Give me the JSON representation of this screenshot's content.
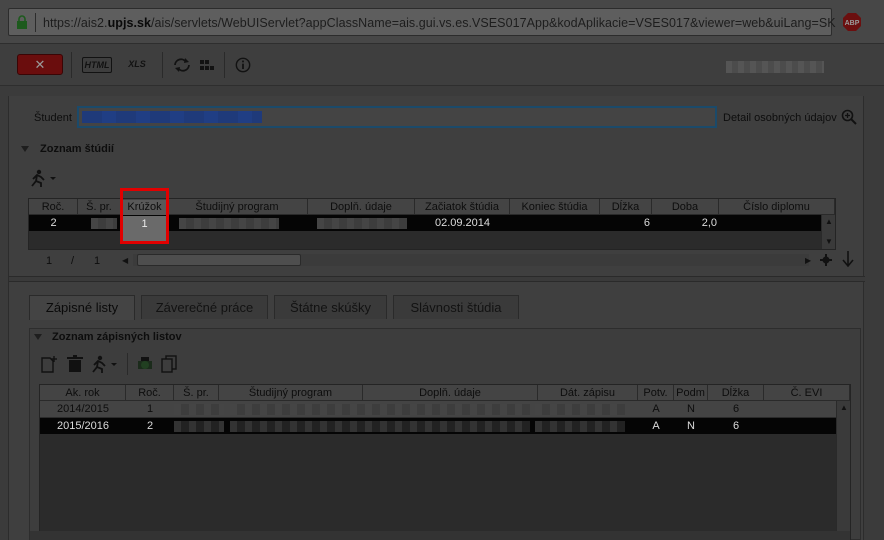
{
  "browser": {
    "url_prefix": "https://ais2.",
    "url_domain": "upjs.sk",
    "url_rest": "/ais/servlets/WebUIServlet?appClassName=ais.gui.vs.es.VSES017App&kodAplikacie=VSES017&viewer=web&uiLang=SK",
    "abp_label": "ABP"
  },
  "toolbar": {
    "close_label": "✕",
    "html_label": "HTML",
    "xls_label": "XLS"
  },
  "student": {
    "label": "Študent",
    "detail_label": "Detail osobných údajov"
  },
  "studies": {
    "title": "Zoznam štúdií",
    "columns": [
      "Roč.",
      "Š. pr.",
      "Krúžok",
      "Študijný program",
      "Doplň. údaje",
      "Začiatok štúdia",
      "Koniec štúdia",
      "Dĺžka",
      "Doba",
      "Číslo diplomu"
    ],
    "row": {
      "roc": "2",
      "kruzok": "1",
      "zaciatok": "02.09.2014",
      "dlzka": "6",
      "doba": "2,0"
    },
    "pager_current": "1",
    "pager_sep": "/",
    "pager_total": "1"
  },
  "tabs": [
    "Zápisné listy",
    "Záverečné práce",
    "Štátne skúšky",
    "Slávnosti štúdia"
  ],
  "enrollment": {
    "title": "Zoznam zápisných listov",
    "columns": [
      "Ak. rok",
      "Roč.",
      "Š. pr.",
      "Študijný program",
      "Doplň. údaje",
      "Dát. zápisu",
      "Potv.",
      "Podm",
      "Dĺžka",
      "Č. EVI"
    ],
    "rows": [
      {
        "ak_rok": "2014/2015",
        "roc": "1",
        "potv": "A",
        "podm": "N",
        "dlzka": "6"
      },
      {
        "ak_rok": "2015/2016",
        "roc": "2",
        "potv": "A",
        "podm": "N",
        "dlzka": "6"
      }
    ]
  },
  "colors": {
    "highlight": "#e10000",
    "close_button": "#6a0d0d",
    "focus_border": "#1b4a6a"
  },
  "icons": [
    "lock-icon",
    "adblock-icon",
    "close-icon",
    "html-export-icon",
    "xls-export-icon",
    "refresh-icon",
    "tree-icon",
    "info-icon",
    "magnifier-icon",
    "run-icon",
    "new-doc-icon",
    "trash-icon",
    "gear-icon",
    "arrow-down-icon"
  ]
}
